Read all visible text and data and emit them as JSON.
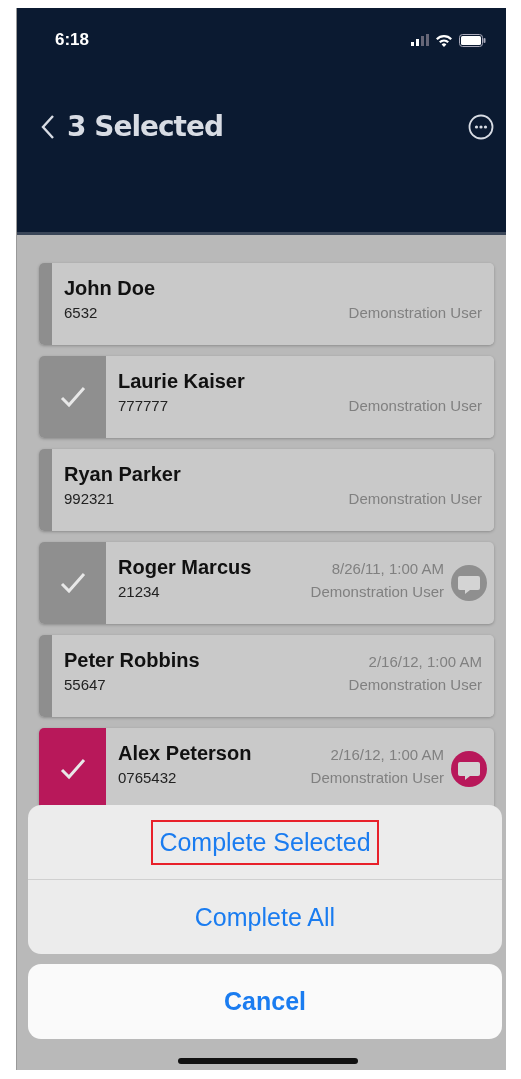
{
  "status_bar": {
    "time": "6:18"
  },
  "nav": {
    "title": "3 Selected"
  },
  "rows": [
    {
      "name": "John Doe",
      "number": "6532",
      "date": "",
      "user": "Demonstration User",
      "selected": false,
      "color": "#8e8e8e",
      "has_message": false
    },
    {
      "name": "Laurie Kaiser",
      "number": "777777",
      "date": "",
      "user": "Demonstration User",
      "selected": true,
      "color": "#8f8f8f",
      "has_message": false
    },
    {
      "name": "Ryan Parker",
      "number": "992321",
      "date": "",
      "user": "Demonstration User",
      "selected": false,
      "color": "#8e8e8e",
      "has_message": false
    },
    {
      "name": "Roger Marcus",
      "number": "21234",
      "date": "8/26/11, 1:00 AM",
      "user": "Demonstration User",
      "selected": true,
      "color": "#8f8f8f",
      "has_message": true
    },
    {
      "name": "Peter Robbins",
      "number": "55647",
      "date": "2/16/12, 1:00 AM",
      "user": "Demonstration User",
      "selected": false,
      "color": "#8e8e8e",
      "has_message": false
    },
    {
      "name": "Alex Peterson",
      "number": "0765432",
      "date": "2/16/12, 1:00 AM",
      "user": "Demonstration User",
      "selected": true,
      "color": "#b8185a",
      "has_message": true
    }
  ],
  "action_sheet": {
    "actions": [
      {
        "label": "Complete Selected",
        "highlighted": true
      },
      {
        "label": "Complete All",
        "highlighted": false
      }
    ],
    "cancel": "Cancel"
  }
}
